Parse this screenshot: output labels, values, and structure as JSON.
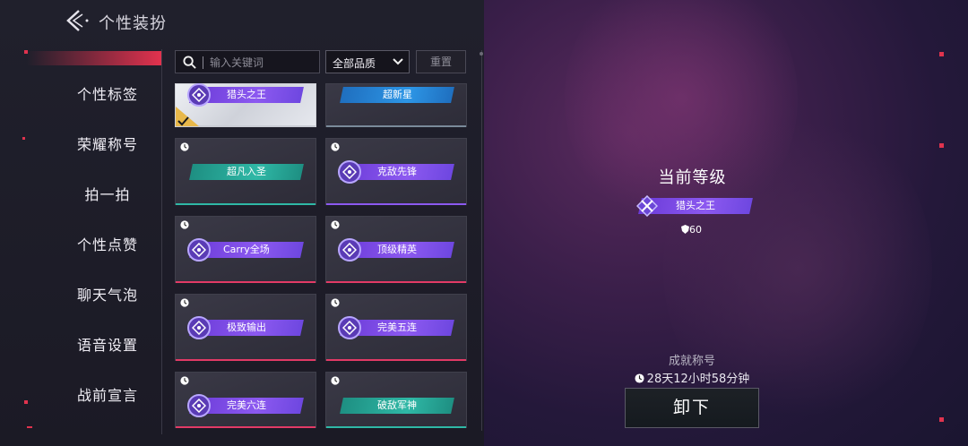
{
  "header": {
    "title": "个性装扮"
  },
  "sidebar": {
    "items": [
      {
        "label": "个性标签"
      },
      {
        "label": "荣耀称号"
      },
      {
        "label": "拍一拍"
      },
      {
        "label": "个性点赞"
      },
      {
        "label": "聊天气泡"
      },
      {
        "label": "语音设置"
      },
      {
        "label": "战前宣言"
      }
    ]
  },
  "toolbar": {
    "search_placeholder": "输入关键词",
    "quality_select": "全部品质",
    "reset_label": "重置"
  },
  "grid": {
    "items": [
      {
        "label": "猎头之王",
        "style": "purple",
        "selected": true,
        "timed": false,
        "underline": "#c9ccd4"
      },
      {
        "label": "超新星",
        "style": "blue",
        "selected": false,
        "timed": false,
        "underline": "#7a8a9a"
      },
      {
        "label": "超凡入圣",
        "style": "teal",
        "selected": false,
        "timed": true,
        "underline": "#2fb8a6"
      },
      {
        "label": "克敌先锋",
        "style": "purple",
        "selected": false,
        "timed": true,
        "underline": "#8c59f0"
      },
      {
        "label": "Carry全场",
        "style": "purple",
        "selected": false,
        "timed": true,
        "underline": "#e23a66"
      },
      {
        "label": "顶级精英",
        "style": "purple",
        "selected": false,
        "timed": true,
        "underline": "#e23a66"
      },
      {
        "label": "极致输出",
        "style": "purple",
        "selected": false,
        "timed": true,
        "underline": "#e23a66"
      },
      {
        "label": "完美五连",
        "style": "purple",
        "selected": false,
        "timed": true,
        "underline": "#e23a66"
      },
      {
        "label": "完美六连",
        "style": "purple",
        "selected": false,
        "timed": true,
        "underline": "#e23a66"
      },
      {
        "label": "破敌军神",
        "style": "teal",
        "selected": false,
        "timed": true,
        "underline": "#2fb8a6"
      }
    ]
  },
  "detail": {
    "level_title": "当前等级",
    "current_tag": "猎头之王",
    "points": "60",
    "achievement_label": "成就称号",
    "time_remaining": "28天12小时58分钟",
    "unequip_label": "卸下"
  },
  "colors": {
    "accent": "#e2324e",
    "purple": "#8c59f0",
    "teal": "#2fb8a6"
  }
}
